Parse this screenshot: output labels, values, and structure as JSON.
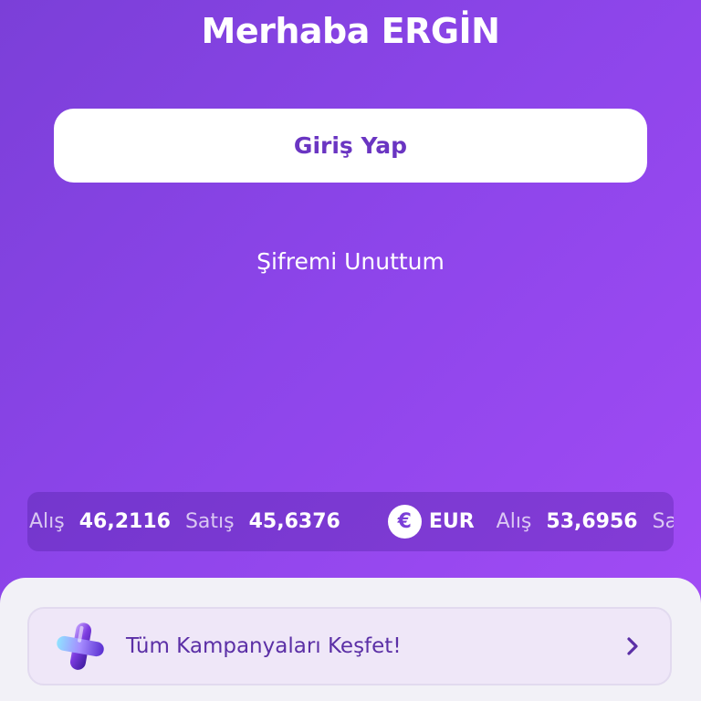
{
  "header": {
    "greeting": "Merhaba ERGİN"
  },
  "actions": {
    "login_label": "Giriş Yap",
    "forgot_label": "Şifremi Unuttum"
  },
  "ticker": {
    "items": [
      {
        "buy_label": "Alış",
        "buy_value": "46,2116",
        "sell_label": "Satış",
        "sell_value": "45,6376"
      },
      {
        "currency_symbol": "€",
        "currency_icon": "euro-icon",
        "currency_code": "EUR",
        "buy_label": "Alış",
        "buy_value": "53,6956",
        "sell_label": "Satış"
      }
    ]
  },
  "campaign": {
    "icon": "plus-3d-icon",
    "label": "Tüm Kampanyaları Keşfet!",
    "chevron_icon": "chevron-right-icon"
  },
  "colors": {
    "background_start": "#7b3fd8",
    "background_end": "#a44cf6",
    "accent_text": "#6a35c2",
    "sheet_background": "#f2f1f7",
    "card_background": "#efe7f8"
  }
}
